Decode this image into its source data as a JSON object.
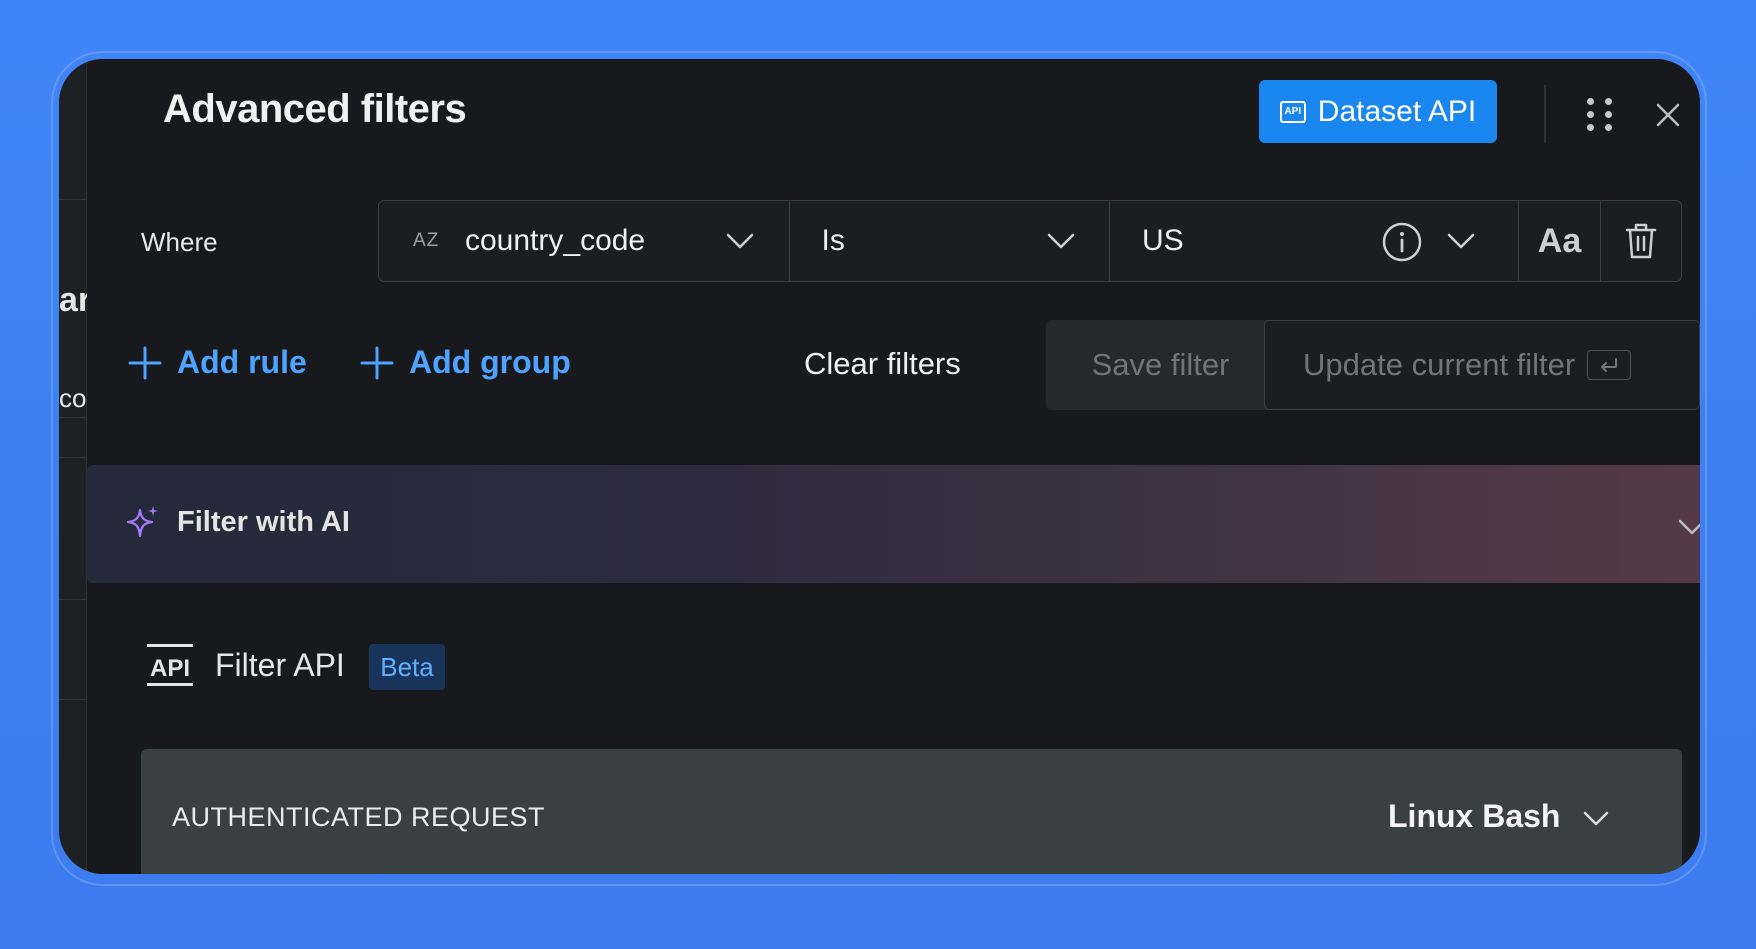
{
  "header": {
    "title": "Advanced filters",
    "dataset_api_label": "Dataset API",
    "api_badge": "API"
  },
  "background_page": {
    "fragment_1": "ar",
    "fragment_2": "co"
  },
  "rule": {
    "where_label": "Where",
    "field_type": "AZ",
    "field": "country_code",
    "operator": "Is",
    "value": "US",
    "case_toggle": "Aa"
  },
  "actions": {
    "add_rule": "Add rule",
    "add_group": "Add group",
    "clear_filters": "Clear filters",
    "save_filter": "Save filter",
    "update_current_filter": "Update current filter"
  },
  "ai": {
    "label": "Filter with AI"
  },
  "filter_api": {
    "logo": "API",
    "label": "Filter API",
    "badge": "Beta"
  },
  "request": {
    "label": "AUTHENTICATED REQUEST",
    "language": "Linux Bash"
  },
  "colors": {
    "background": "#3f84f8",
    "panel": "#17191c",
    "accent": "#1a86f0",
    "link": "#4da3ff",
    "ai_purple": "#8b5cf6"
  }
}
